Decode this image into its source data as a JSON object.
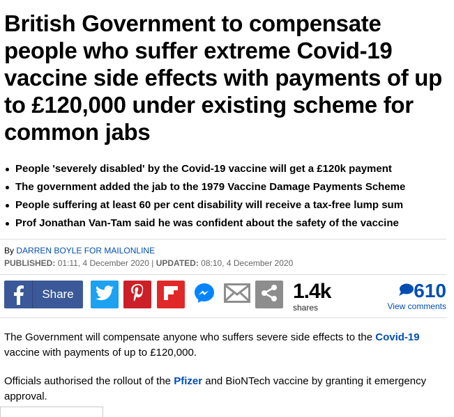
{
  "article": {
    "headline": "British Government to compensate people who suffer extreme Covid-19 vaccine side effects with payments of up to £120,000 under existing scheme for common jabs",
    "bullets": [
      "People 'severely disabled' by the Covid-19 vaccine will get a £120k payment",
      "The government added the jab to the 1979 Vaccine Damage Payments Scheme",
      "People suffering at least 60 per cent disability will receive a tax-free lump sum",
      "Prof Jonathan Van-Tam said he was confident about the safety of the vaccine"
    ],
    "byline": {
      "prefix": "By",
      "author": "DARREN BOYLE FOR MAILONLINE"
    },
    "dates": {
      "published_label": "PUBLISHED:",
      "published": "01:11, 4 December 2020",
      "separator": "|",
      "updated_label": "UPDATED:",
      "updated": "08:10, 4 December 2020"
    },
    "share": {
      "facebook_label": "Share",
      "share_count": "1.4k",
      "share_count_label": "shares",
      "comment_count": "610",
      "comment_label": "View comments",
      "icons": [
        "facebook-icon",
        "twitter-icon",
        "pinterest-icon",
        "flipboard-icon",
        "messenger-icon",
        "email-icon",
        "share-icon",
        "comment-bubble-icon"
      ]
    },
    "paragraphs": {
      "p1_before": "The Government will compensate anyone who suffers severe side effects to the",
      "p1_link": "Covid-19",
      "p1_after": "vaccine with payments of up to £120,000.",
      "p2_before": "Officials authorised the rollout of the",
      "p2_link": "Pfizer",
      "p2_after": "and BioNTech vaccine by granting it emergency approval."
    },
    "colors": {
      "link": "#004db3",
      "facebook": "#3b5998",
      "twitter": "#1da1f2",
      "pinterest": "#cb2027",
      "flipboard": "#e12828",
      "messenger": "#0084ff",
      "share_grey": "#8d8d8d"
    }
  }
}
